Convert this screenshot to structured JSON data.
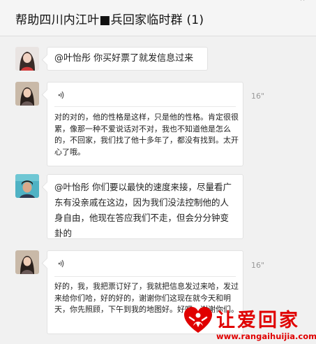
{
  "header": {
    "title": "帮助四川内江叶■兵回家临时群 (1)",
    "corner_icon": "more-icon"
  },
  "messages": [
    {
      "type": "text",
      "avatar": "avatar-woman-1",
      "text": "@叶怡彤 你买好票了就发信息过来"
    },
    {
      "type": "voice",
      "avatar": "avatar-woman-2",
      "duration": "16\"",
      "transcript": "对的对的，他的性格是这样，只是他的性格。肯定很很累，像那一种不爱说话对不对，我也不知道他是怎么的，不回家，我们找了他十多年了，都没有找到。太开心了哦。"
    },
    {
      "type": "text",
      "avatar": "avatar-man",
      "text": "@叶怡彤 你们要以最快的速度来接，尽量看广东有没亲戚在这边，因为我们没法控制他的人身自由，他现在答应我们不走，但会分分钟变卦的"
    },
    {
      "type": "voice",
      "avatar": "avatar-woman-2",
      "duration": "16\"",
      "transcript": "好的，我，我把票订好了，我就把信息发过来哈，发过来给你们哈，好的好的，谢谢你们这现在就今天和明天，你先照顾，下午到我的地图好。好吧，谢谢你们。"
    }
  ],
  "watermark": {
    "title": "让爱回家",
    "url": "www.rangaihuijia.com",
    "color": "#e00000"
  }
}
